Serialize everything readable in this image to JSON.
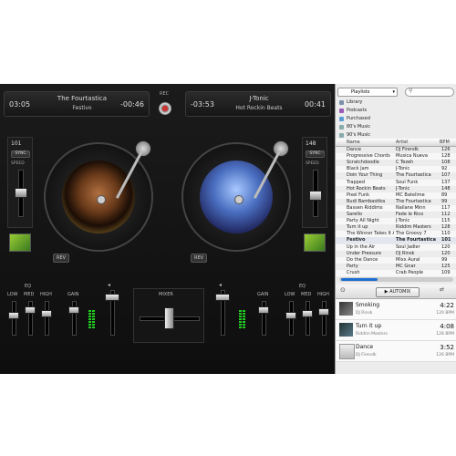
{
  "deck_left": {
    "time_elapsed": "03:05",
    "time_remaining": "-00:46",
    "title": "The Fourtastica",
    "artist": "Festivo",
    "bpm": "101",
    "sync": "SYNC",
    "speed": "SPEED",
    "rev": "REV"
  },
  "deck_right": {
    "time_elapsed": "-03:53",
    "time_remaining": "00:41",
    "title": "J-Tonic",
    "artist": "Hot Rockin Beats",
    "bpm": "148",
    "sync": "SYNC",
    "speed": "SPEED",
    "rev": "REV"
  },
  "rec_label": "REC",
  "mixer": {
    "label": "MIXER",
    "eq": "EQ",
    "low": "LOW",
    "med": "MED",
    "high": "HIGH",
    "gain": "GAIN"
  },
  "library": {
    "dropdown": "Playlists",
    "sources": [
      "Library",
      "Podcasts",
      "Purchased",
      "80's Music",
      "90's Music"
    ],
    "columns": {
      "name": "Name",
      "artist": "Artist",
      "bpm": "BPM"
    },
    "tracks": [
      {
        "name": "Dance",
        "artist": "DJ Firendk",
        "bpm": "126"
      },
      {
        "name": "Progressive Chords",
        "artist": "Musica Nueva",
        "bpm": "128"
      },
      {
        "name": "Scratchdoodle",
        "artist": "C Tezeh",
        "bpm": "108"
      },
      {
        "name": "Black Jam",
        "artist": "J-Tonic",
        "bpm": "92"
      },
      {
        "name": "Doin Your Thing",
        "artist": "The Fourtastica",
        "bpm": "107"
      },
      {
        "name": "Trapped",
        "artist": "Soul Funk",
        "bpm": "137"
      },
      {
        "name": "Hot Rockin Beats",
        "artist": "J-Tonic",
        "bpm": "148"
      },
      {
        "name": "Pixel Funk",
        "artist": "MC Batelime",
        "bpm": "89"
      },
      {
        "name": "Budi Bambastika",
        "artist": "The Fourtastica",
        "bpm": "99"
      },
      {
        "name": "Bassen Riddims",
        "artist": "Nallane Minn",
        "bpm": "117"
      },
      {
        "name": "Sarello",
        "artist": "Fede le Rico",
        "bpm": "112"
      },
      {
        "name": "Party All Night",
        "artist": "J-Tonic",
        "bpm": "115"
      },
      {
        "name": "Turn it up",
        "artist": "Riddim Masters",
        "bpm": "128"
      },
      {
        "name": "The Winner Takes It All",
        "artist": "The Groovy 7",
        "bpm": "110"
      },
      {
        "name": "Festivo",
        "artist": "The Fourtastica",
        "bpm": "101"
      },
      {
        "name": "Up in the Air",
        "artist": "Soul Jadler",
        "bpm": "120"
      },
      {
        "name": "Under Pressure",
        "artist": "DJ Rinsk",
        "bpm": "120"
      },
      {
        "name": "Do the Dance",
        "artist": "Mixx Aural",
        "bpm": "99"
      },
      {
        "name": "Party",
        "artist": "MC Gnar",
        "bpm": "125"
      },
      {
        "name": "Crush",
        "artist": "Crab People",
        "bpm": "109"
      }
    ],
    "automix": "AUTOMIX",
    "queue": [
      {
        "title": "Smoking",
        "artist": "DJ Rinsk",
        "duration": "4:22",
        "bpm": "120 BPM"
      },
      {
        "title": "Turn it up",
        "artist": "Riddim Masters",
        "duration": "4:08",
        "bpm": "128 BPM"
      },
      {
        "title": "Dance",
        "artist": "DJ Firendk",
        "duration": "3:52",
        "bpm": "126 BPM"
      }
    ]
  },
  "colors": {
    "accent": "#1f6fd0",
    "effect_green": "#7ab82a",
    "vu_green": "#22cc22"
  }
}
